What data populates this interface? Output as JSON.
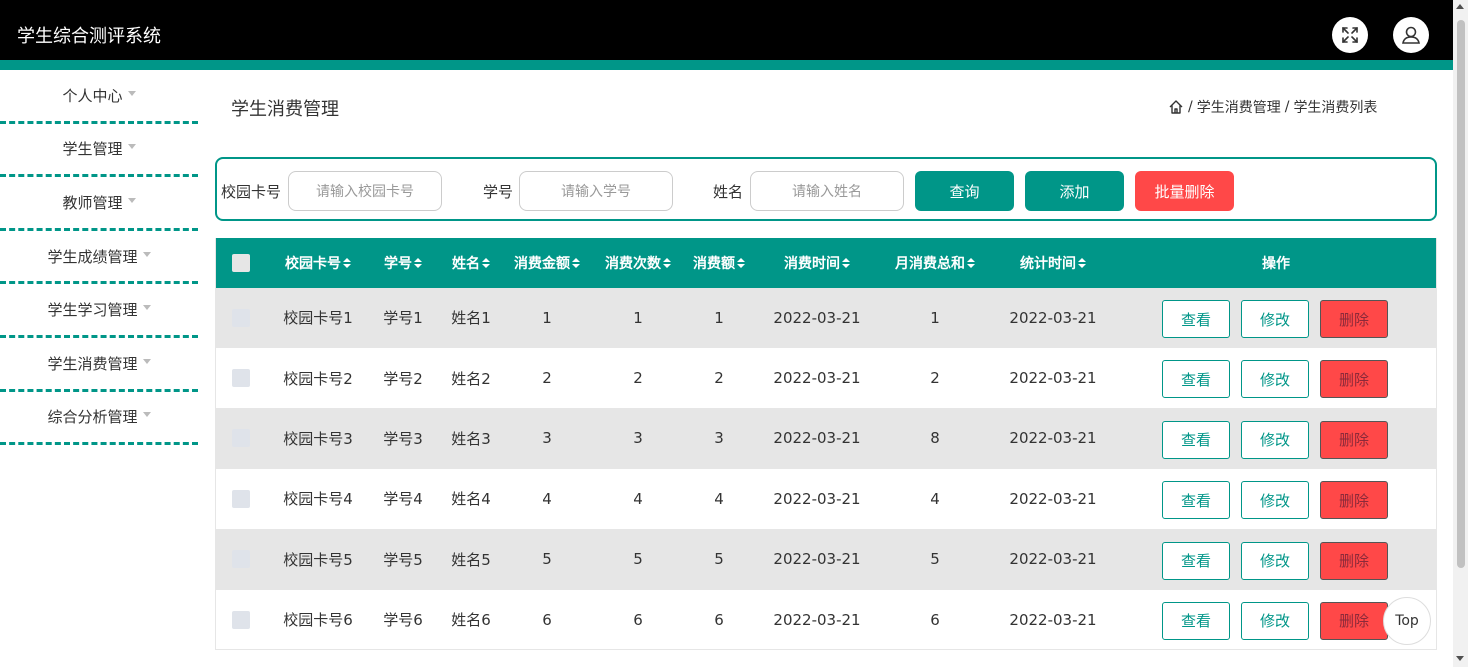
{
  "app": {
    "title": "学生综合测评系统"
  },
  "header_icons": {
    "fullscreen": "expand-icon",
    "user": "user-icon"
  },
  "sidebar": {
    "items": [
      {
        "label": "个人中心"
      },
      {
        "label": "学生管理"
      },
      {
        "label": "教师管理"
      },
      {
        "label": "学生成绩管理"
      },
      {
        "label": "学生学习管理"
      },
      {
        "label": "学生消费管理"
      },
      {
        "label": "综合分析管理"
      }
    ]
  },
  "page": {
    "title": "学生消费管理",
    "breadcrumb": {
      "sep1": "/",
      "item1": "学生消费管理",
      "sep2": "/",
      "item2": "学生消费列表"
    }
  },
  "search": {
    "card_label": "校园卡号",
    "card_placeholder": "请输入校园卡号",
    "id_label": "学号",
    "id_placeholder": "请输入学号",
    "name_label": "姓名",
    "name_placeholder": "请输入姓名",
    "query_label": "查询",
    "add_label": "添加",
    "batch_delete_label": "批量删除"
  },
  "table": {
    "columns": [
      "校园卡号",
      "学号",
      "姓名",
      "消费金额",
      "消费次数",
      "消费额",
      "消费时间",
      "月消费总和",
      "统计时间",
      "操作"
    ],
    "rows": [
      {
        "card": "校园卡号1",
        "sid": "学号1",
        "name": "姓名1",
        "amount": "1",
        "times": "1",
        "sum": "1",
        "time": "2022-03-21",
        "monthly": "1",
        "stat_time": "2022-03-21"
      },
      {
        "card": "校园卡号2",
        "sid": "学号2",
        "name": "姓名2",
        "amount": "2",
        "times": "2",
        "sum": "2",
        "time": "2022-03-21",
        "monthly": "2",
        "stat_time": "2022-03-21"
      },
      {
        "card": "校园卡号3",
        "sid": "学号3",
        "name": "姓名3",
        "amount": "3",
        "times": "3",
        "sum": "3",
        "time": "2022-03-21",
        "monthly": "8",
        "stat_time": "2022-03-21"
      },
      {
        "card": "校园卡号4",
        "sid": "学号4",
        "name": "姓名4",
        "amount": "4",
        "times": "4",
        "sum": "4",
        "time": "2022-03-21",
        "monthly": "4",
        "stat_time": "2022-03-21"
      },
      {
        "card": "校园卡号5",
        "sid": "学号5",
        "name": "姓名5",
        "amount": "5",
        "times": "5",
        "sum": "5",
        "time": "2022-03-21",
        "monthly": "5",
        "stat_time": "2022-03-21"
      },
      {
        "card": "校园卡号6",
        "sid": "学号6",
        "name": "姓名6",
        "amount": "6",
        "times": "6",
        "sum": "6",
        "time": "2022-03-21",
        "monthly": "6",
        "stat_time": "2022-03-21"
      }
    ],
    "actions": {
      "view": "查看",
      "edit": "修改",
      "delete": "删除"
    }
  },
  "back_to_top": "Top",
  "colors": {
    "primary": "#009688",
    "danger": "#ff4848",
    "header": "#000000",
    "row_alt": "#e6e6e6"
  }
}
